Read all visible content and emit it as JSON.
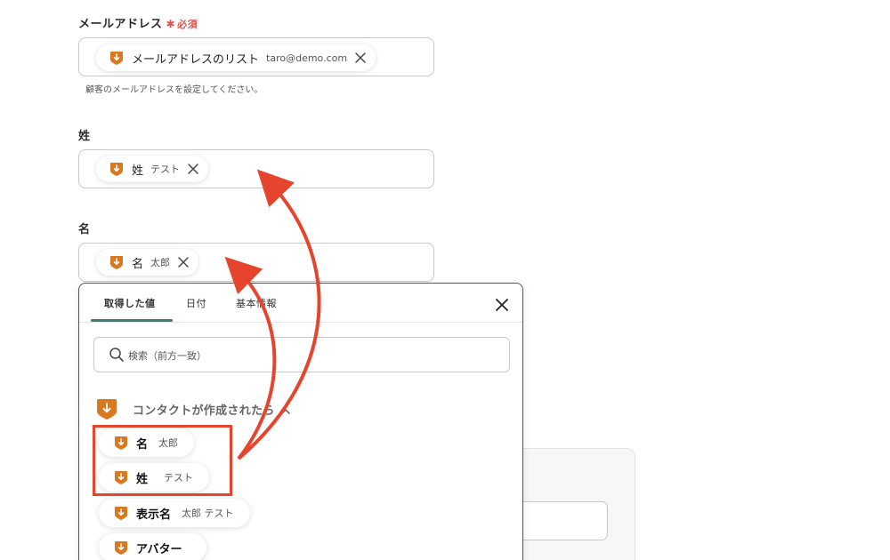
{
  "colors": {
    "accent_orange": "#d9781f",
    "required_red": "#e0524a",
    "annotation_red": "#e5452c",
    "tab_underline": "#3f7a78"
  },
  "icons": {
    "app": "orange-badge-download-icon",
    "remove": "close-x-icon",
    "search": "search-icon",
    "chevron": "chevron-up-icon"
  },
  "form": {
    "email": {
      "label": "メールアドレス",
      "required_mark": "✱",
      "required_text": "必須",
      "tag": {
        "name": "メールアドレスのリスト",
        "value": "taro@demo.com"
      },
      "hint": "顧客のメールアドレスを設定してください。"
    },
    "last_name": {
      "label": "姓",
      "tag": {
        "name": "姓",
        "value": "テスト"
      }
    },
    "first_name": {
      "label": "名",
      "tag": {
        "name": "名",
        "value": "太郎"
      }
    }
  },
  "dropdown": {
    "tabs": [
      {
        "label": "取得した値",
        "active": true
      },
      {
        "label": "日付",
        "active": false
      },
      {
        "label": "基本情報",
        "active": false
      }
    ],
    "search_placeholder": "検索（前方一致）",
    "group_title": "コンタクトが作成されたら",
    "options": [
      {
        "name": "名",
        "value": "太郎"
      },
      {
        "name": "姓",
        "value": "テスト"
      },
      {
        "name": "表示名",
        "value": "太郎 テスト"
      },
      {
        "name": "アバター",
        "value": ""
      }
    ]
  }
}
